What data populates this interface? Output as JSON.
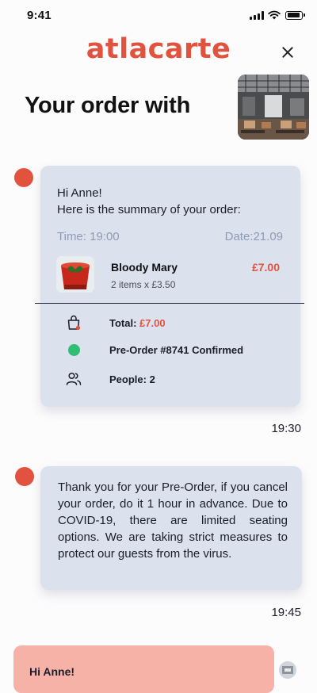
{
  "status_bar": {
    "time": "9:41",
    "icons": [
      "cellular-signal-icon",
      "wifi-icon",
      "battery-icon"
    ]
  },
  "header": {
    "logo": "atlacarte",
    "close_icon": "close-icon",
    "title": "Your order with"
  },
  "colors": {
    "brand": "#e2533f",
    "card_bg": "#dce1ee",
    "muted": "#8f9bb3",
    "confirmed": "#2fbf72",
    "highlight_card": "#f7b2a8"
  },
  "order_message": {
    "greeting": "Hi Anne!",
    "summary": "Here is the summary of your order:",
    "time_label": "Time: 19:00",
    "date_label": "Date:21.09",
    "item": {
      "name": "Bloody Mary",
      "quantity": "2 items x £3.50",
      "price": "£7.00"
    },
    "total_label": "Total:",
    "total_value": "£7.00",
    "status": "Pre-Order #8741 Confirmed",
    "people": "People: 2",
    "timestamp": "19:30"
  },
  "notice_message": {
    "text": "Thank you for your Pre-Order, if you cancel your order, do it 1 hour in advance. Due to COVID-19, there are limited seating options. We are taking strict measures to protect our guests from the virus.",
    "timestamp": "19:45"
  },
  "next_message": {
    "text": "Hi Anne!"
  }
}
